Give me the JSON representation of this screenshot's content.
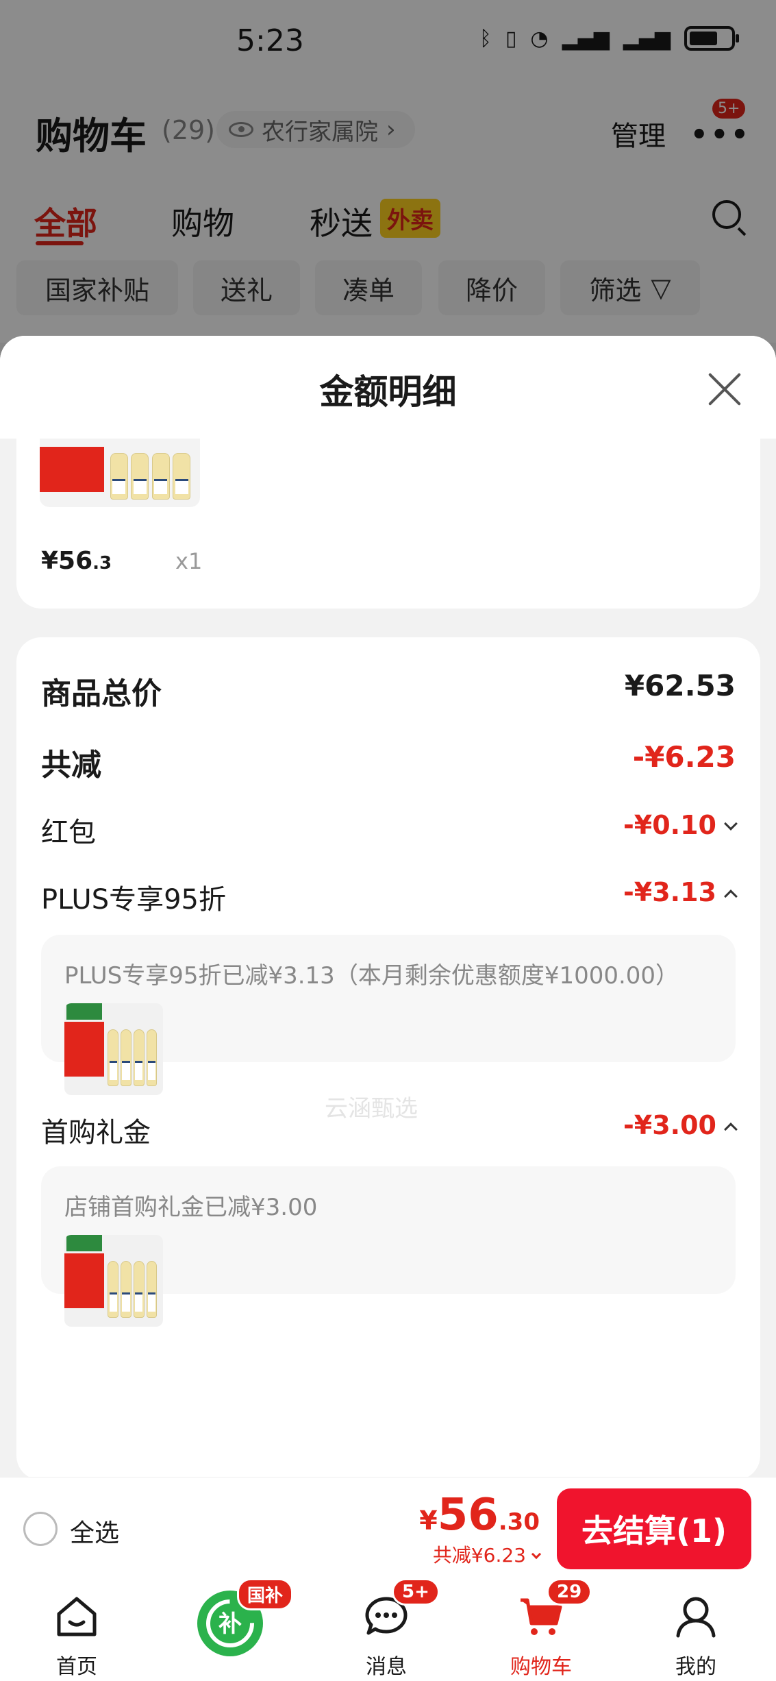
{
  "status_bar": {
    "time": "5:23"
  },
  "cart_header": {
    "title": "购物车",
    "count": "(29)",
    "address": "农行家属院",
    "manage_label": "管理",
    "more_badge": "5+"
  },
  "tabs": [
    {
      "label": "全部"
    },
    {
      "label": "购物"
    },
    {
      "label": "秒送"
    }
  ],
  "tab_badge": "外卖",
  "chips": [
    "国家补贴",
    "送礼",
    "凑单",
    "降价",
    "筛选"
  ],
  "sheet": {
    "title": "金额明细",
    "product": {
      "price_int": "¥56",
      "price_dec": ".3",
      "qty": "x1"
    },
    "summary": {
      "total_label": "商品总价",
      "total_value": "¥62.53",
      "reduce_label": "共减",
      "reduce_value": "-¥6.23",
      "redpacket_label": "红包",
      "redpacket_value": "-¥0.10",
      "plus_label": "PLUS专享95折",
      "plus_value": "-¥3.13",
      "plus_detail": "PLUS专享95折已减¥3.13（本月剩余优惠额度¥1000.00）",
      "first_label": "首购礼金",
      "first_value": "-¥3.00",
      "first_detail": "店铺首购礼金已减¥3.00"
    },
    "watermark": "云涵甄选"
  },
  "checkout": {
    "select_all": "全选",
    "price_yen": "¥",
    "price_int": "56",
    "price_dec": ".30",
    "discount": "共减¥6.23",
    "button": "去结算(1)"
  },
  "bottom_nav": [
    {
      "label": "首页",
      "icon": "home-icon"
    },
    {
      "label": "",
      "icon": "subsidy-icon",
      "badge": "国补"
    },
    {
      "label": "消息",
      "icon": "message-icon",
      "badge": "5+"
    },
    {
      "label": "购物车",
      "icon": "cart-icon",
      "badge": "29"
    },
    {
      "label": "我的",
      "icon": "profile-icon"
    }
  ],
  "colors": {
    "accent": "#e1251b",
    "button": "#f0142d"
  }
}
